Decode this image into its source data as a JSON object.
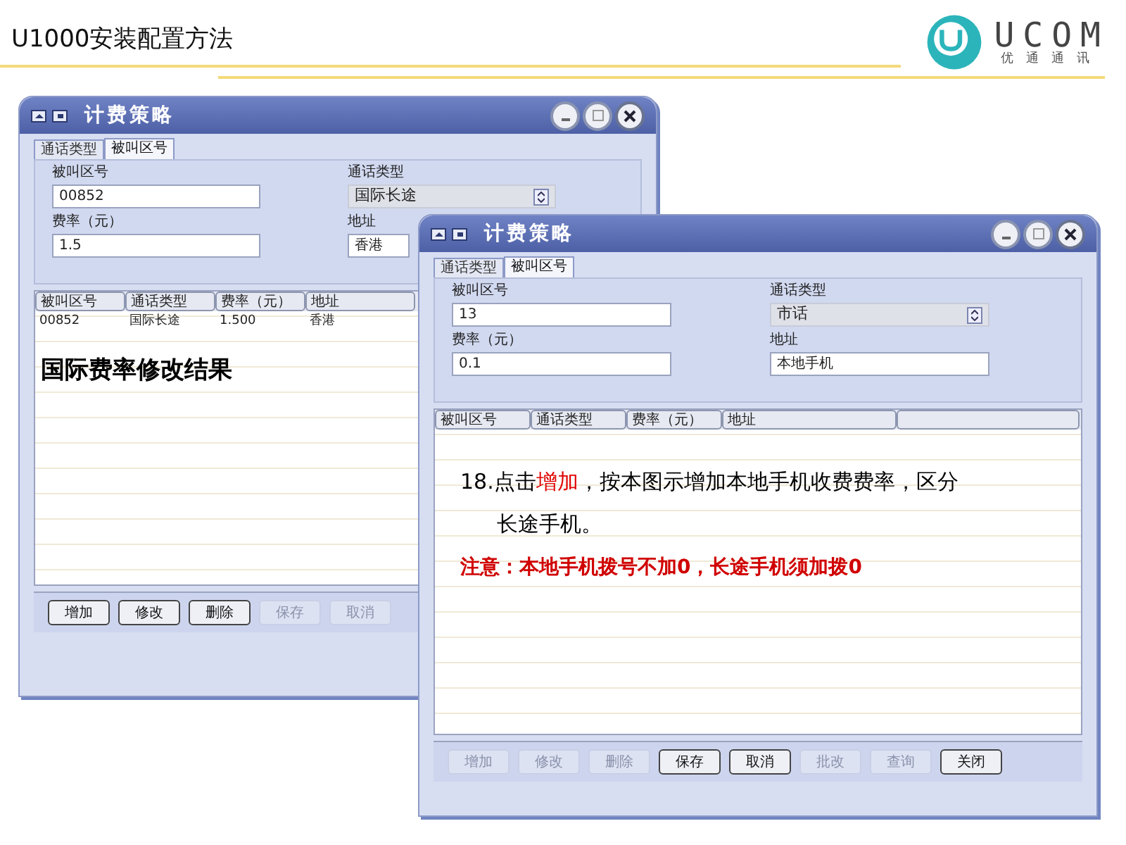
{
  "slide": {
    "title": "U1000安装配置方法",
    "logo": {
      "brand": "UCOM",
      "tagline": "优通通讯"
    }
  },
  "windows": [
    {
      "title": "计费策略",
      "tabs": [
        {
          "label": "通话类型",
          "selected": false
        },
        {
          "label": "被叫区号",
          "selected": true
        }
      ],
      "fields": [
        {
          "label": "被叫区号",
          "kind": "text",
          "value": "00852"
        },
        {
          "label": "通话类型",
          "kind": "select",
          "value": "国际长途"
        },
        {
          "label": "费率（元）",
          "kind": "text",
          "value": "1.5"
        },
        {
          "label": "地址",
          "kind": "text",
          "value": "香港"
        }
      ],
      "table": {
        "columns": [
          "被叫区号",
          "通话类型",
          "费率（元）",
          "地址"
        ],
        "rows": [
          [
            "00852",
            "国际长途",
            "1.500",
            "香港"
          ]
        ]
      },
      "annotation": "国际费率修改结果",
      "buttons": [
        {
          "label": "增加",
          "disabled": false
        },
        {
          "label": "修改",
          "disabled": false
        },
        {
          "label": "删除",
          "disabled": false
        },
        {
          "label": "保存",
          "disabled": true
        },
        {
          "label": "取消",
          "disabled": true
        }
      ]
    },
    {
      "title": "计费策略",
      "tabs": [
        {
          "label": "通话类型",
          "selected": false
        },
        {
          "label": "被叫区号",
          "selected": true
        }
      ],
      "fields": [
        {
          "label": "被叫区号",
          "kind": "text",
          "value": "13"
        },
        {
          "label": "通话类型",
          "kind": "select",
          "value": "市话"
        },
        {
          "label": "费率（元）",
          "kind": "text",
          "value": "0.1"
        },
        {
          "label": "地址",
          "kind": "text",
          "value": "本地手机"
        }
      ],
      "table": {
        "columns": [
          "被叫区号",
          "通话类型",
          "费率（元）",
          "地址"
        ]
      },
      "instruction": {
        "before": "18.点击",
        "highlight": "增加",
        "after": "，按本图示增加本地手机收费费率，区分长途手机。"
      },
      "note": "注意：本地手机拨号不加0，长途手机须加拨0",
      "buttons": [
        {
          "label": "增加",
          "disabled": true
        },
        {
          "label": "修改",
          "disabled": true
        },
        {
          "label": "删除",
          "disabled": true
        },
        {
          "label": "保存",
          "disabled": false
        },
        {
          "label": "取消",
          "disabled": false
        },
        {
          "label": "批改",
          "disabled": true
        },
        {
          "label": "查询",
          "disabled": true
        },
        {
          "label": "关闭",
          "disabled": false
        }
      ]
    }
  ]
}
